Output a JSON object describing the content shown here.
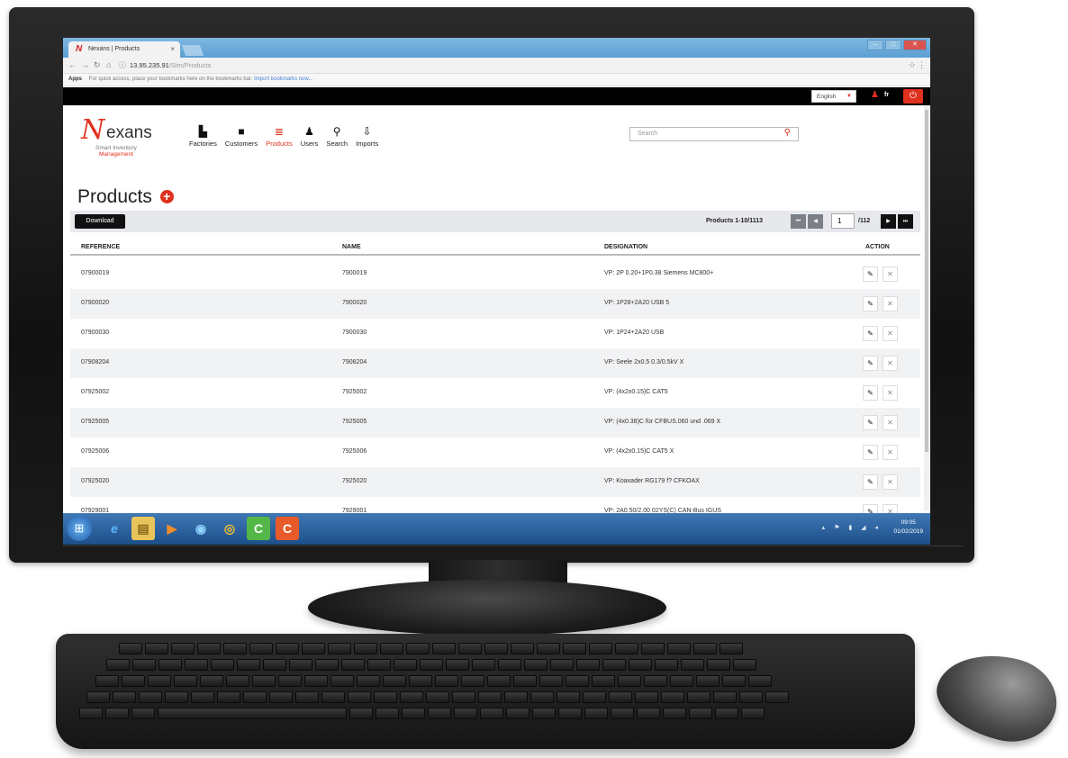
{
  "browser": {
    "tab_title": "Nexans | Products",
    "tab_close": "×",
    "url_host": "13.95.235.91",
    "url_path": "/Sim/Products",
    "bookmarks_apps": "Apps",
    "bookmarks_text": "For quick access, place your bookmarks here on the bookmarks bar.",
    "bookmarks_import": "Import bookmarks now..."
  },
  "topbar": {
    "language": "English",
    "user_lang": "fr"
  },
  "logo": {
    "mark": "N",
    "word": "exans",
    "sub_line1": "Smart Inventory",
    "sub_line2": "Management"
  },
  "nav": {
    "items": [
      {
        "label": "Factories",
        "icon": "factory-icon"
      },
      {
        "label": "Customers",
        "icon": "folder-icon"
      },
      {
        "label": "Products",
        "icon": "products-icon"
      },
      {
        "label": "Users",
        "icon": "user-icon"
      },
      {
        "label": "Search",
        "icon": "search-icon"
      },
      {
        "label": "Imports",
        "icon": "import-icon"
      }
    ],
    "active": "Products"
  },
  "search": {
    "placeholder": "Search"
  },
  "page": {
    "title": "Products"
  },
  "toolbar": {
    "download_label": "Download",
    "count_label": "Products 1-10/1113",
    "current_page": "1",
    "total_pages": "/112"
  },
  "table": {
    "columns": [
      "REFERENCE",
      "NAME",
      "DESIGNATION",
      "ACTION"
    ],
    "rows": [
      {
        "reference": "07900019",
        "name": "7900019",
        "designation": "VP: 2P 0.20+1P0.38 Siemens MC800+"
      },
      {
        "reference": "07900020",
        "name": "7900020",
        "designation": "VP: 1P28+2A20 USB 5"
      },
      {
        "reference": "07900030",
        "name": "7900030",
        "designation": "VP: 1P24+2A20 USB"
      },
      {
        "reference": "07908204",
        "name": "7908204",
        "designation": "VP: Seele 2x0.5 0.3/0.5kV X"
      },
      {
        "reference": "07925002",
        "name": "7925002",
        "designation": "VP: (4x2x0.15)C CAT5"
      },
      {
        "reference": "07925005",
        "name": "7925005",
        "designation": "VP: (4x0.38)C für CFBUS.060 und .069 X"
      },
      {
        "reference": "07925006",
        "name": "7925006",
        "designation": "VP: (4x2x0.15)C CAT5 X"
      },
      {
        "reference": "07925020",
        "name": "7925020",
        "designation": "VP: Koaxader RG179 f? CFKOAX"
      },
      {
        "reference": "07929001",
        "name": "7929001",
        "designation": "VP: 2A0.50/2.00 02YS(C) CAN-Bus IGUS"
      }
    ]
  },
  "taskbar": {
    "time": "09:05",
    "date": "01/02/2019"
  },
  "colors": {
    "accent": "#e0301e",
    "taskbar": "#1d4f8a"
  }
}
